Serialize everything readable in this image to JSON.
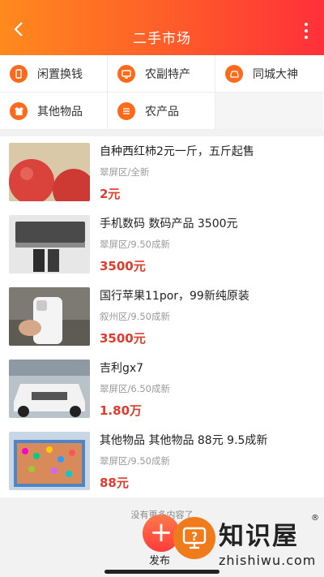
{
  "header": {
    "title": "二手市场"
  },
  "categories": [
    {
      "label": "闲置换钱",
      "icon": "phone-icon"
    },
    {
      "label": "农副特产",
      "icon": "tv-icon"
    },
    {
      "label": "同城大神",
      "icon": "car-icon"
    },
    {
      "label": "其他物品",
      "icon": "shirt-icon"
    },
    {
      "label": "农产品",
      "icon": "list-icon"
    }
  ],
  "items": [
    {
      "title": "自种西红柿2元一斤，五斤起售",
      "location": "翠屏区/全新",
      "price": "2元"
    },
    {
      "title": "手机数码 数码产品 3500元",
      "location": "翠屏区/9.50成新",
      "price": "3500元"
    },
    {
      "title": "国行苹果11por，99新纯原装",
      "location": "叙州区/9.50成新",
      "price": "3500元"
    },
    {
      "title": "吉利gx7",
      "location": "翠屏区/6.50成新",
      "price": "1.80万"
    },
    {
      "title": "其他物品 其他物品 88元 9.5成新",
      "location": "翠屏区/9.50成新",
      "price": "88元"
    }
  ],
  "footer": {
    "text": "没有更多内容了",
    "publish": "发布"
  },
  "watermark": {
    "brand": "知识屋",
    "site": "zhishiwu.com",
    "reg": "®"
  },
  "colors": {
    "accent": "#ff5a2a",
    "price": "#e33a2b"
  }
}
